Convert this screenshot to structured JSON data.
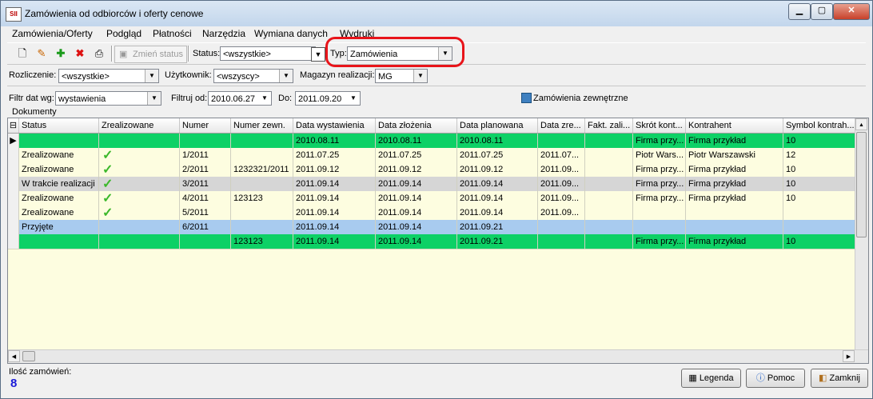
{
  "window": {
    "title": "Zamówienia od odbiorców i oferty cenowe",
    "app_icon": "SII"
  },
  "menu": [
    "Zamówienia/Oferty",
    "Podgląd",
    "Płatności",
    "Narzędzia",
    "Wymiana danych",
    "Wydruki"
  ],
  "toolbar": {
    "change_status_label": "Zmień status",
    "status_label": "Status:",
    "status_value": "<wszystkie>",
    "typ_label": "Typ:",
    "typ_value": "Zamówienia"
  },
  "filters": {
    "rozliczenie_label": "Rozliczenie:",
    "rozliczenie_value": "<wszystkie>",
    "uzytkownik_label": "Użytkownik:",
    "uzytkownik_value": "<wszyscy>",
    "magazyn_label": "Magazyn realizacji:",
    "magazyn_value": "MG",
    "filtr_dat_label": "Filtr dat wg:",
    "filtr_dat_value": "wystawienia",
    "filtruj_od_label": "Filtruj od:",
    "filtruj_od_value": "2010.06.27",
    "do_label": "Do:",
    "do_value": "2011.09.20",
    "zamowienia_zewn_label": "Zamówienia zewnętrzne"
  },
  "documents_label": "Dokumenty",
  "table": {
    "columns": [
      "Status",
      "Zrealizowane",
      "Numer",
      "Numer zewn.",
      "Data wystawienia",
      "Data złożenia",
      "Data planowana",
      "Data zre...",
      "Fakt. zali...",
      "Skrót kont...",
      "Kontrahent",
      "Symbol kontrah..."
    ],
    "rows": [
      {
        "style": "green",
        "cells": [
          "",
          "",
          "",
          "",
          "2010.08.11",
          "2010.08.11",
          "2010.08.11",
          "",
          "",
          "Firma przy...",
          "Firma przykład",
          "10"
        ],
        "check": false,
        "current": true
      },
      {
        "style": "cream",
        "cells": [
          "Zrealizowane",
          "",
          "1/2011",
          "",
          "2011.07.25",
          "2011.07.25",
          "2011.07.25",
          "2011.07...",
          "",
          "Piotr Wars...",
          "Piotr Warszawski",
          "12"
        ],
        "check": true
      },
      {
        "style": "cream",
        "cells": [
          "Zrealizowane",
          "",
          "2/2011",
          "1232321/2011",
          "2011.09.12",
          "2011.09.12",
          "2011.09.12",
          "2011.09...",
          "",
          "Firma przy...",
          "Firma przykład",
          "10"
        ],
        "check": true
      },
      {
        "style": "gray",
        "cells": [
          "W trakcie realizacji",
          "",
          "3/2011",
          "",
          "2011.09.14",
          "2011.09.14",
          "2011.09.14",
          "2011.09...",
          "",
          "Firma przy...",
          "Firma przykład",
          "10"
        ],
        "check": true
      },
      {
        "style": "cream",
        "cells": [
          "Zrealizowane",
          "",
          "4/2011",
          "123123",
          "2011.09.14",
          "2011.09.14",
          "2011.09.14",
          "2011.09...",
          "",
          "Firma przy...",
          "Firma przykład",
          "10"
        ],
        "check": true
      },
      {
        "style": "cream",
        "cells": [
          "Zrealizowane",
          "",
          "5/2011",
          "",
          "2011.09.14",
          "2011.09.14",
          "2011.09.14",
          "2011.09...",
          "",
          "",
          "",
          ""
        ],
        "check": true
      },
      {
        "style": "blue",
        "cells": [
          "Przyjęte",
          "",
          "6/2011",
          "",
          "2011.09.14",
          "2011.09.14",
          "2011.09.21",
          "",
          "",
          "",
          "",
          ""
        ],
        "check": false
      },
      {
        "style": "green",
        "cells": [
          "",
          "",
          "",
          "123123",
          "2011.09.14",
          "2011.09.14",
          "2011.09.21",
          "",
          "",
          "Firma przy...",
          "Firma przykład",
          "10"
        ],
        "check": false
      }
    ]
  },
  "footer": {
    "count_label": "Ilość zamówień:",
    "count_value": "8",
    "legenda": "Legenda",
    "pomoc": "Pomoc",
    "zamknij": "Zamknij"
  },
  "colors": {
    "green": "#0dd166",
    "cream": "#fdfde0",
    "gray": "#d6d6d6",
    "blue": "#a8cbef",
    "highlight": "#e8141a"
  }
}
